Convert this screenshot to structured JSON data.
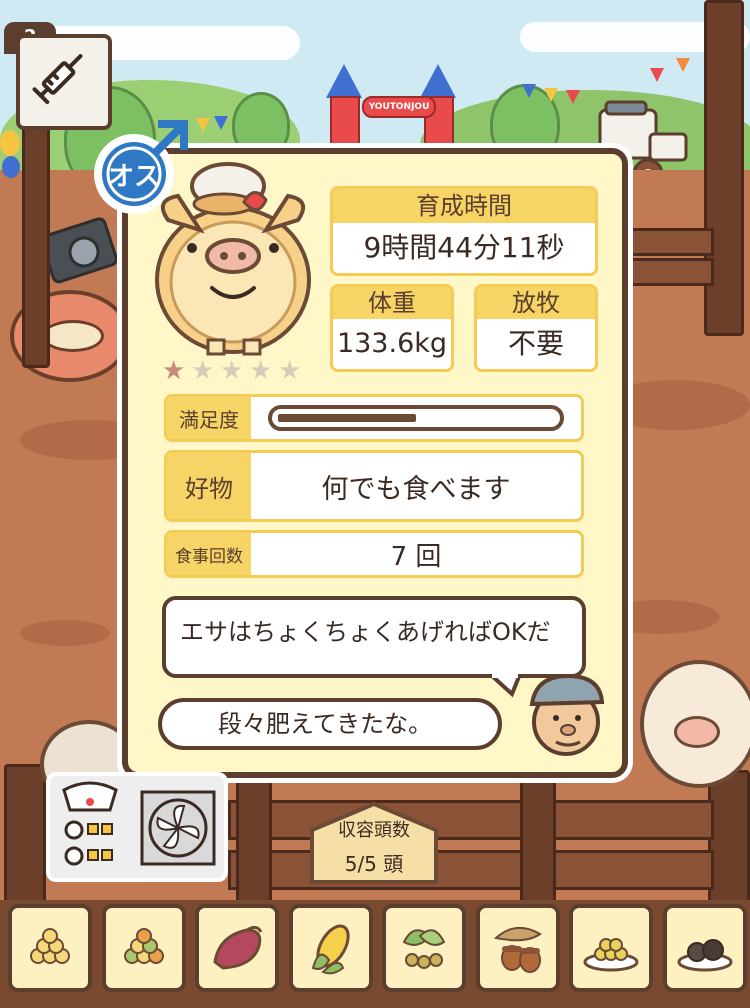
{
  "game": {
    "item_count": "2",
    "item_icon": "syringe-icon",
    "gate_sign": "YOUTONJOU"
  },
  "pig": {
    "sex_label": "オス",
    "sex_icon": "male-symbol-icon",
    "rating": {
      "value": 1,
      "max": 5
    }
  },
  "stats": {
    "raise_time_label": "育成時間",
    "raise_time_value": "9時間44分11秒",
    "weight_label": "体重",
    "weight_value": "133.6kg",
    "graze_label": "放牧",
    "graze_value": "不要",
    "satisfaction_label": "満足度",
    "satisfaction_level": 0.5,
    "favorite_label": "好物",
    "favorite_value": "何でも食べます",
    "meals_label": "食事回数",
    "meals_value": "7 回"
  },
  "dialogue": {
    "hint": "エサはちょくちょくあげればOKだ",
    "comment": "段々肥えてきたな。"
  },
  "barn": {
    "capacity_label": "収容頭数",
    "capacity_value": "5/5 頭"
  },
  "feeds": [
    {
      "icon": "grain-pile-icon"
    },
    {
      "icon": "mixed-grain-icon"
    },
    {
      "icon": "sweet-potato-icon"
    },
    {
      "icon": "corn-icon"
    },
    {
      "icon": "leaf-beans-icon"
    },
    {
      "icon": "acorn-icon"
    },
    {
      "icon": "grain-plate-icon"
    },
    {
      "icon": "truffle-plate-icon"
    }
  ],
  "colors": {
    "panel_bg": "#fff7c8",
    "label_yellow": "#f6d466",
    "border_brown": "#5b3e2e",
    "male_blue": "#2f78c4",
    "star_filled": "#c88a7a",
    "star_empty": "#d6cdb8"
  }
}
